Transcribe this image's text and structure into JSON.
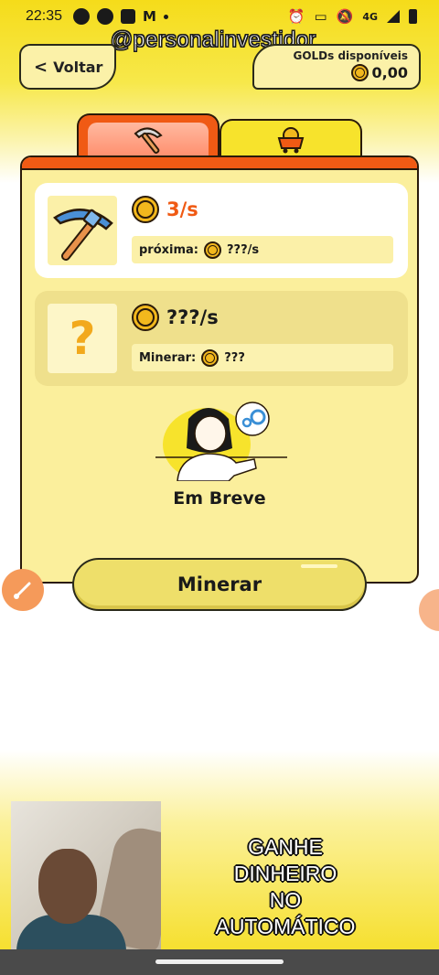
{
  "status_bar": {
    "time": "22:35",
    "network": "4G"
  },
  "watermark": "@personalinvestidor_",
  "header": {
    "back_label": "Voltar",
    "golds_label": "GOLDs disponíveis",
    "golds_value": "0,00"
  },
  "tabs": [
    {
      "icon": "pickaxe-icon",
      "active": true
    },
    {
      "icon": "mine-cart-icon",
      "active": false
    }
  ],
  "tools": [
    {
      "rate": "3/s",
      "sub_label": "próxima:",
      "sub_value": "???/s",
      "locked": false
    },
    {
      "rate": "???/s",
      "sub_label": "Minerar:",
      "sub_value": "???",
      "locked": true
    }
  ],
  "coming_soon": "Em Breve",
  "mine_button": "Minerar",
  "promo": [
    "GANHE",
    "DINHEIRO",
    "NO",
    "AUTOMÁTICO"
  ],
  "colors": {
    "accent_orange": "#f05a14",
    "brand_yellow": "#f5dc1a",
    "coin_gold": "#f2b81d"
  }
}
